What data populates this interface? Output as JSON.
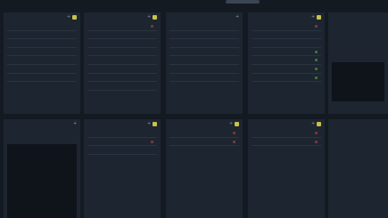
{
  "top_tab": {
    "label": ""
  },
  "panels": {
    "p1": {
      "title": "",
      "items": [
        "",
        "",
        "",
        "",
        "",
        "",
        ""
      ]
    },
    "p2": {
      "title": "",
      "items": [
        "",
        "",
        "",
        "",
        "",
        "",
        "",
        ""
      ]
    },
    "p3": {
      "title": "",
      "items": [
        "",
        "",
        "",
        "",
        "",
        "",
        ""
      ]
    },
    "p4": {
      "title": "",
      "items": [
        "",
        "",
        "",
        "",
        "",
        "",
        ""
      ]
    },
    "p5": {
      "title": ""
    },
    "p6": {
      "title": ""
    },
    "p7": {
      "title": "",
      "items": [
        "",
        "",
        ""
      ]
    },
    "p8": {
      "title": "",
      "items": [
        "",
        ""
      ]
    },
    "p9": {
      "title": "",
      "items": [
        "",
        ""
      ]
    },
    "p10": {
      "title": ""
    }
  },
  "colors": {
    "background": "#141a22",
    "panel": "#1d2530",
    "accent": "#c8c24a",
    "dot_green": "#3f7a3a",
    "dot_red": "#7a3a3a"
  }
}
